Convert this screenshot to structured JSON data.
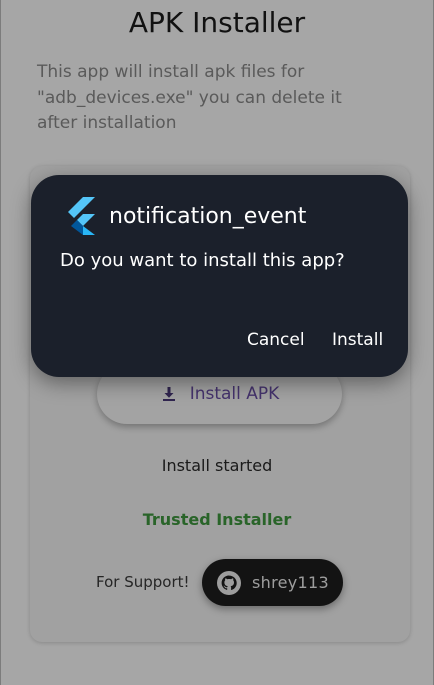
{
  "app": {
    "title": "APK Installer",
    "description": "This app will install apk files for \"adb_devices.exe\" you can delete it after installation"
  },
  "main": {
    "install_button_label": "Install APK",
    "install_button_icon": "download-icon",
    "status_text": "Install started",
    "trusted_text": "Trusted Installer",
    "trusted_color": "#3f9a3f",
    "support_label": "For Support!",
    "github_button_label": "shrey113",
    "github_icon": "github-icon"
  },
  "dialog": {
    "app_icon": "flutter-logo-icon",
    "title": "notification_event",
    "message": "Do you want to install this app?",
    "cancel_label": "Cancel",
    "install_label": "Install",
    "background_color": "#1b202b"
  }
}
